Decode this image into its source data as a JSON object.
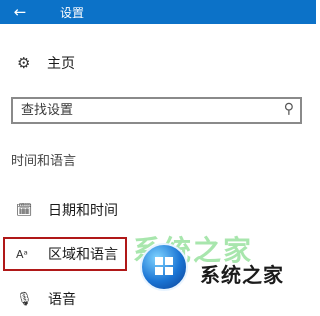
{
  "window": {
    "title": "设置",
    "back_icon": "arrow-left-icon",
    "titlebar_color": "#0c72c8"
  },
  "home": {
    "label": "主页",
    "icon": "gear-icon"
  },
  "search": {
    "placeholder": "查找设置",
    "icon": "search-icon"
  },
  "section": {
    "title": "时间和语言"
  },
  "nav": {
    "items": [
      {
        "label": "日期和时间",
        "icon": "calendar-clock-icon"
      },
      {
        "label": "区域和语言",
        "icon": "region-language-icon",
        "selected": true
      },
      {
        "label": "语音",
        "icon": "microphone-icon"
      }
    ]
  },
  "watermark": {
    "text": "系统之家",
    "faint_text": "系统之家"
  },
  "colors": {
    "selection_border": "#b01818"
  }
}
